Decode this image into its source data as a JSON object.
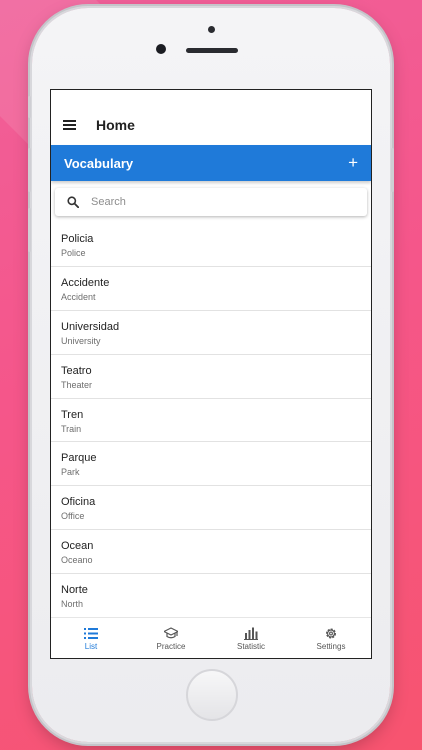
{
  "header": {
    "title": "Home"
  },
  "vocabulary": {
    "title": "Vocabulary",
    "add_icon": "plus-icon"
  },
  "search": {
    "placeholder": "Search",
    "value": ""
  },
  "words": [
    {
      "word": "Policia",
      "translation": "Police"
    },
    {
      "word": "Accidente",
      "translation": "Accident"
    },
    {
      "word": "Universidad",
      "translation": "University"
    },
    {
      "word": "Teatro",
      "translation": "Theater"
    },
    {
      "word": "Tren",
      "translation": "Train"
    },
    {
      "word": "Parque",
      "translation": "Park"
    },
    {
      "word": "Oficina",
      "translation": "Office"
    },
    {
      "word": "Ocean",
      "translation": "Oceano"
    },
    {
      "word": "Norte",
      "translation": "North"
    }
  ],
  "nav": {
    "items": [
      {
        "label": "List",
        "icon": "list-icon",
        "active": true
      },
      {
        "label": "Practice",
        "icon": "graduation-cap-icon",
        "active": false
      },
      {
        "label": "Statistic",
        "icon": "bar-chart-icon",
        "active": false
      },
      {
        "label": "Settings",
        "icon": "gear-icon",
        "active": false
      }
    ]
  },
  "colors": {
    "accent": "#1f7ad9",
    "background_gradient_start": "#f0609a",
    "background_gradient_end": "#f7546f",
    "inactive_nav": "#555555"
  }
}
